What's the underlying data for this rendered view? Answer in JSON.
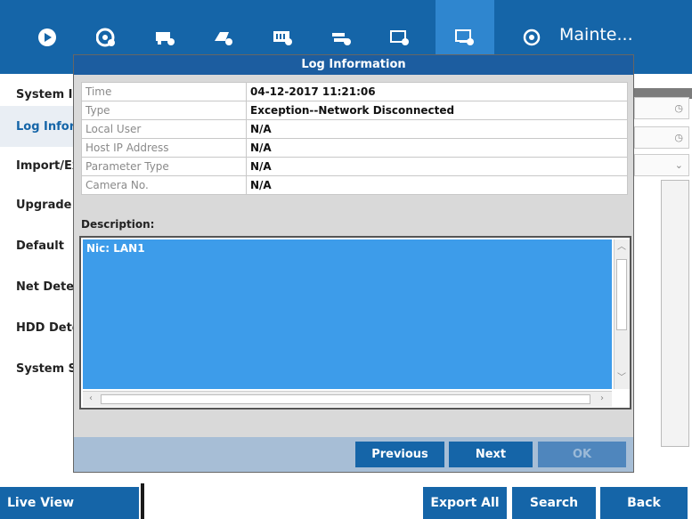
{
  "menu": {
    "icons": [
      "live-view-icon",
      "camera-settings-icon",
      "record-icon",
      "playback-icon",
      "storage-icon",
      "network-icon",
      "system-config-icon",
      "maintenance-icon",
      "info-icon"
    ],
    "active_index": 7,
    "title": "Mainte..."
  },
  "sidebar": {
    "items": [
      {
        "label": "System In"
      },
      {
        "label": "Log Inforr"
      },
      {
        "label": "Import/Ex"
      },
      {
        "label": "Upgrade"
      },
      {
        "label": "Default"
      },
      {
        "label": "Net Detec"
      },
      {
        "label": "HDD Dete"
      },
      {
        "label": "System Se"
      }
    ],
    "selected_index": 1
  },
  "dialog": {
    "title": "Log Information",
    "fields": [
      {
        "label": "Time",
        "value": "04-12-2017 11:21:06"
      },
      {
        "label": "Type",
        "value": "Exception--Network Disconnected"
      },
      {
        "label": "Local User",
        "value": "N/A"
      },
      {
        "label": "Host IP Address",
        "value": "N/A"
      },
      {
        "label": "Parameter Type",
        "value": "N/A"
      },
      {
        "label": "Camera No.",
        "value": "N/A"
      }
    ],
    "description_label": "Description:",
    "description_text": "Nic: LAN1",
    "buttons": {
      "previous": "Previous",
      "next": "Next",
      "ok": "OK"
    }
  },
  "bottom": {
    "live_view": "Live View",
    "export_all": "Export All",
    "search": "Search",
    "back": "Back"
  },
  "colors": {
    "primary": "#1565a8",
    "accent": "#2f86cf",
    "selection": "#3d9cea",
    "footer": "#a7bed6"
  }
}
